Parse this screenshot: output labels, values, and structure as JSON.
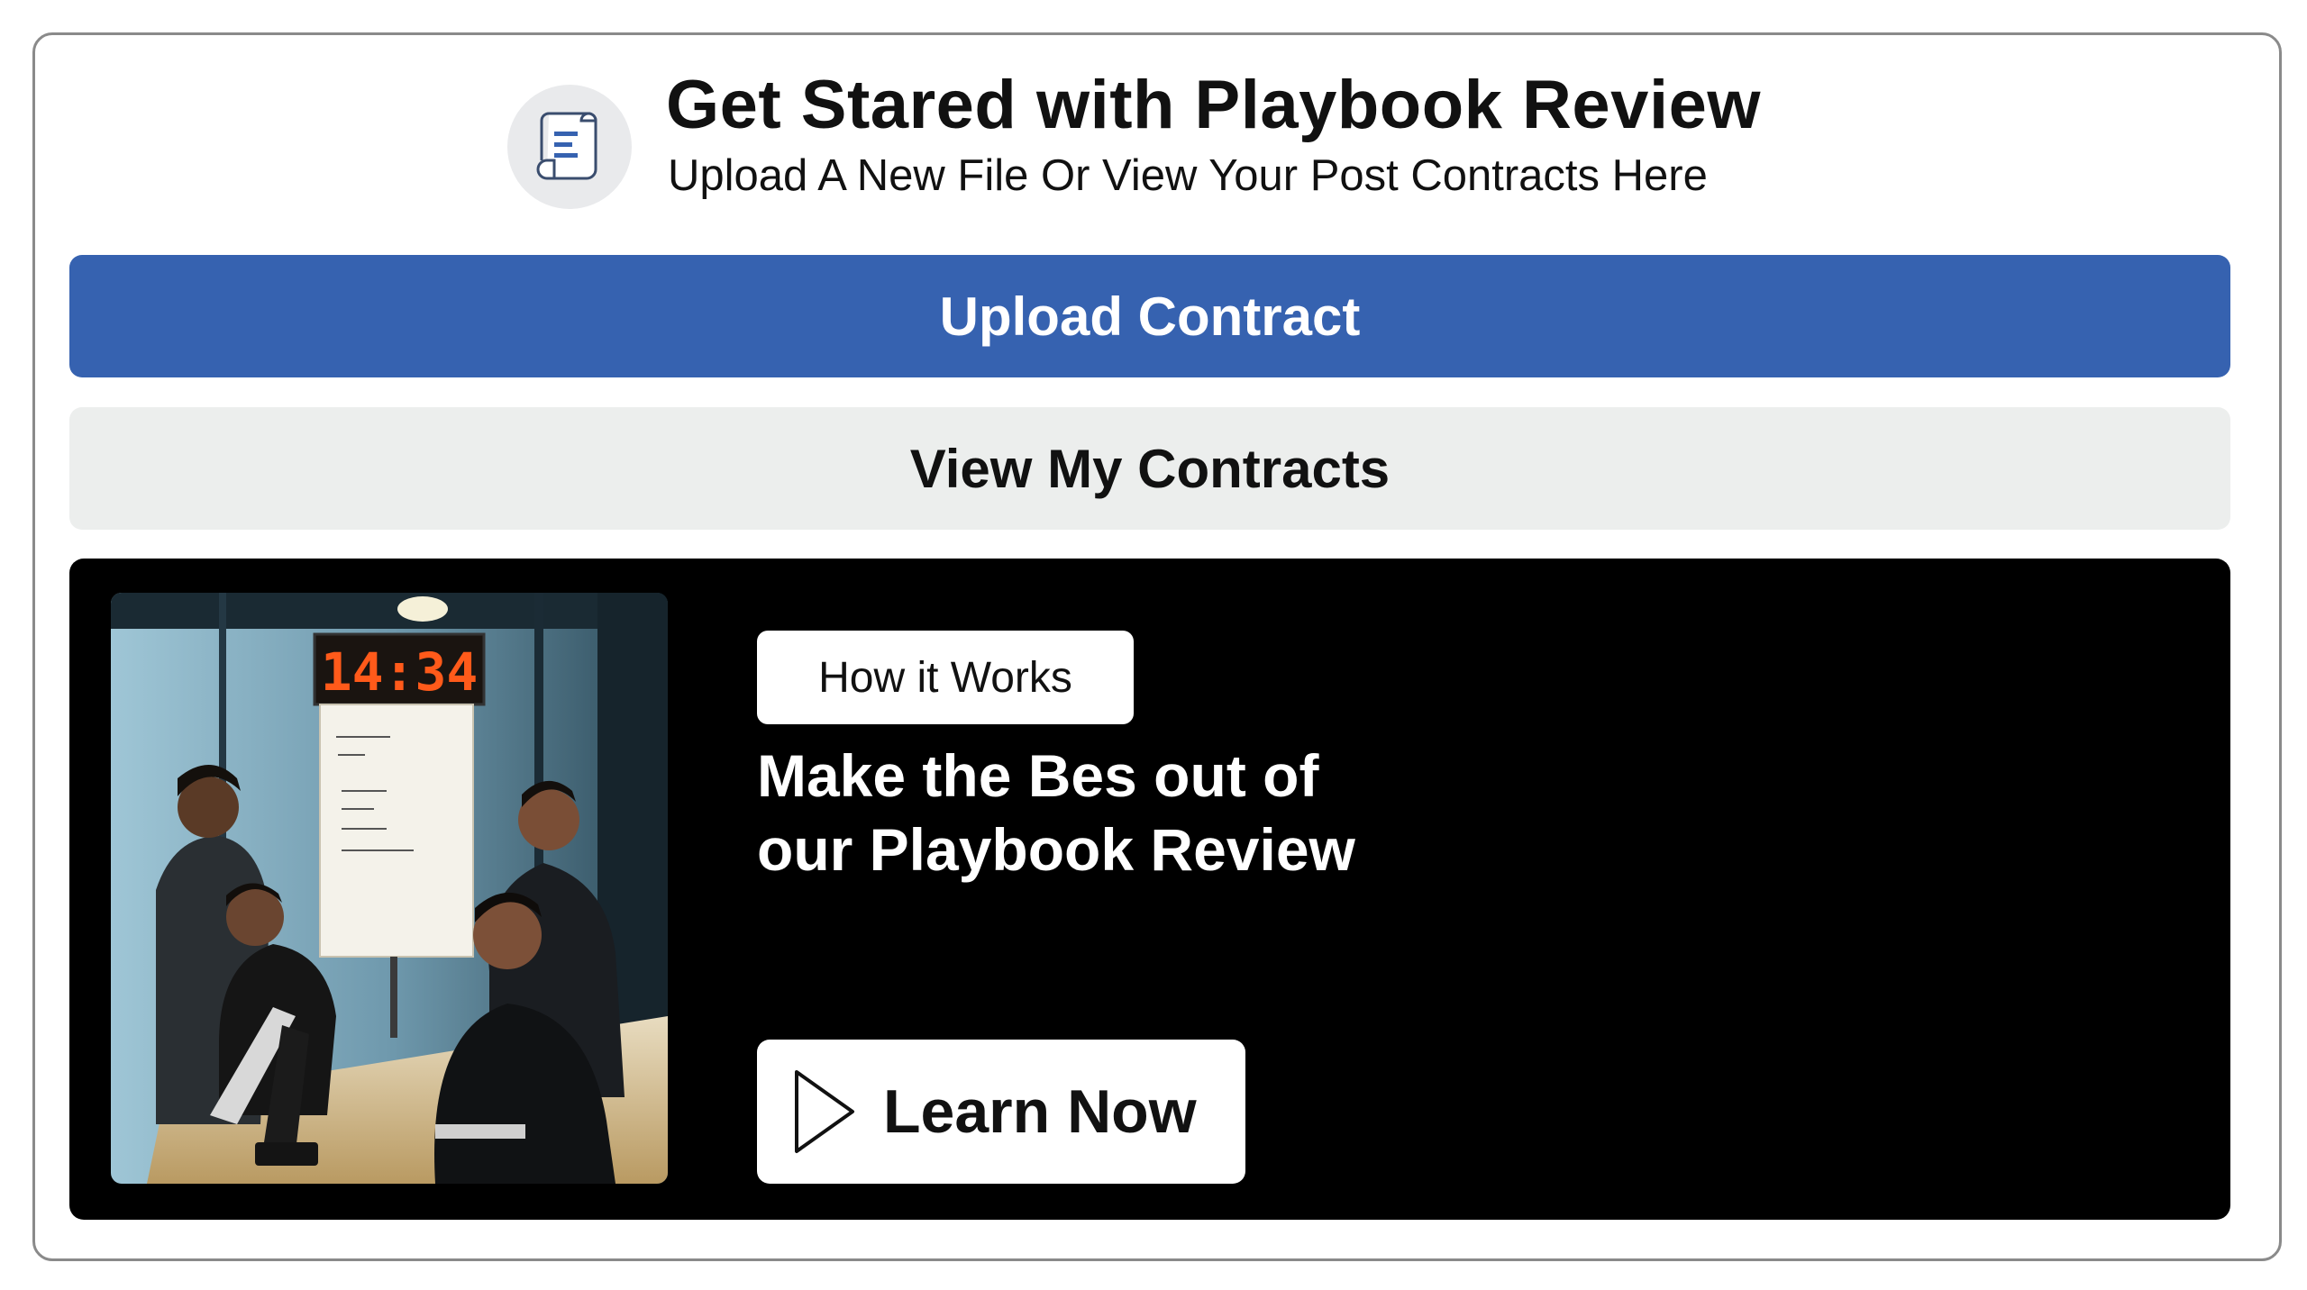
{
  "header": {
    "title": "Get Stared with Playbook Review",
    "subtitle": "Upload A New File Or View Your Post Contracts Here",
    "icon": "document-scroll-icon"
  },
  "actions": {
    "upload_label": "Upload Contract",
    "view_label": "View My Contracts"
  },
  "promo": {
    "tag": "How it Works",
    "headline_line1": "Make the Bes out of",
    "headline_line2": "our Playbook Review",
    "cta_label": "Learn Now",
    "cta_icon": "play-icon",
    "photo": {
      "clock": "14:34",
      "alt": "business-meeting-photo"
    }
  },
  "colors": {
    "primary": "#3662b0",
    "secondary_button": "#eceeed",
    "promo_bg": "#000000",
    "clock_digits": "#ff5a1a"
  }
}
